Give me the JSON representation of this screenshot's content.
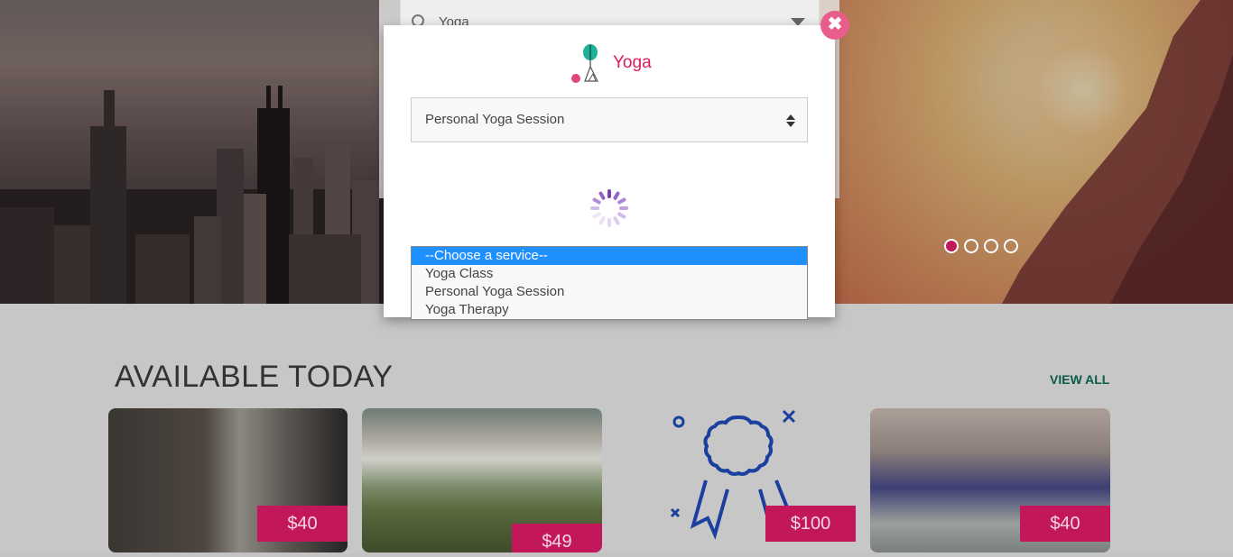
{
  "search": {
    "value": "Yoga"
  },
  "carousel": {
    "dots": 4,
    "active": 0
  },
  "section": {
    "title": "AVAILABLE TODAY",
    "view_all": "VIEW ALL"
  },
  "cards": [
    {
      "price": "$40"
    },
    {
      "price": "$49"
    },
    {
      "price": "$100"
    },
    {
      "price": "$40"
    }
  ],
  "modal": {
    "title": "Yoga",
    "selected_service": "Personal Yoga Session",
    "options": [
      "--Choose a service--",
      "Yoga Class",
      "Personal Yoga Session",
      "Yoga Therapy"
    ],
    "highlighted_option": "--Choose a service--",
    "close_icon": "close-icon"
  },
  "colors": {
    "accent": "#d81b60",
    "price_bg": "#c2185b",
    "close_bg": "#e85d8a",
    "highlight": "#1e90ff",
    "view_all": "#0a5a4a"
  }
}
